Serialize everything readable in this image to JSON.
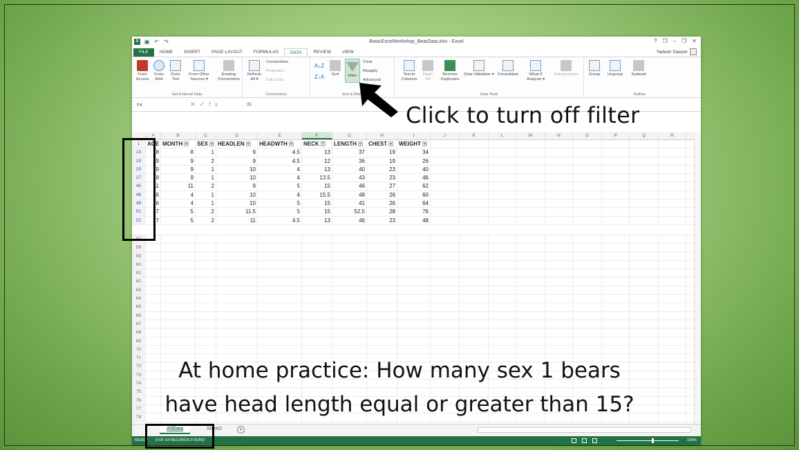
{
  "window": {
    "title": "BasicExcelWorkshop_BearData.xlsx - Excel",
    "controls": [
      "?",
      "❐",
      "–",
      "❐",
      "✕"
    ],
    "user": "Yadeeh Sawyer"
  },
  "tabs": [
    "FILE",
    "HOME",
    "INSERT",
    "PAGE LAYOUT",
    "FORMULAS",
    "DATA",
    "REVIEW",
    "VIEW"
  ],
  "active_tab": "DATA",
  "ribbon": {
    "get_external_data": {
      "name": "Get External Data",
      "buttons": [
        "From Access",
        "From Web",
        "From Text",
        "From Other Sources ▾",
        "Existing Connections"
      ]
    },
    "connections": {
      "name": "Connections",
      "refresh": "Refresh All ▾",
      "items": [
        "Connections",
        "Properties",
        "Edit Links"
      ]
    },
    "sort_filter": {
      "name": "Sort & Filter",
      "sort": "Sort",
      "filter": "Filter",
      "items": [
        "Clear",
        "Reapply",
        "Advanced"
      ]
    },
    "data_tools": {
      "name": "Data Tools",
      "buttons": [
        "Text to Columns",
        "Flash Fill",
        "Remove Duplicates",
        "Data Validation ▾",
        "Consolidate",
        "What-If Analysis ▾",
        "Relationships"
      ]
    },
    "outline": {
      "name": "Outline",
      "buttons": [
        "Group",
        "Ungroup",
        "Subtotal"
      ]
    }
  },
  "formula_bar": {
    "name_box": "F4",
    "value": "31"
  },
  "columns": [
    "A",
    "B",
    "C",
    "D",
    "E",
    "F",
    "G",
    "H",
    "I",
    "J",
    "K",
    "L",
    "M",
    "N",
    "O",
    "P",
    "Q",
    "R"
  ],
  "selected_column": "F",
  "headers": [
    "AGE",
    "MONTH",
    "SEX",
    "HEADLEN",
    "HEADWTH",
    "NECK",
    "LENGTH",
    "CHEST",
    "WEIGHT"
  ],
  "filtered_header": "NECK",
  "header_row_number": "1",
  "data_rows": [
    {
      "rn": "13",
      "vals": [
        "8",
        "8",
        "1",
        "9",
        "4.5",
        "13",
        "37",
        "19",
        "34"
      ]
    },
    {
      "rn": "19",
      "vals": [
        "9",
        "9",
        "2",
        "9",
        "4.5",
        "12",
        "36",
        "19",
        "26"
      ]
    },
    {
      "rn": "25",
      "vals": [
        "9",
        "9",
        "1",
        "10",
        "4",
        "13",
        "40",
        "23",
        "40"
      ]
    },
    {
      "rn": "27",
      "vals": [
        "9",
        "9",
        "1",
        "10",
        "4",
        "13.5",
        "43",
        "23",
        "46"
      ]
    },
    {
      "rn": "45",
      "vals": [
        "11",
        "11",
        "2",
        "9",
        "5",
        "15",
        "46",
        "27",
        "62"
      ]
    },
    {
      "rn": "48",
      "vals": [
        "16",
        "4",
        "1",
        "10",
        "4",
        "15.5",
        "48",
        "26",
        "60"
      ]
    },
    {
      "rn": "49",
      "vals": [
        "16",
        "4",
        "1",
        "10",
        "5",
        "15",
        "41",
        "26",
        "64"
      ]
    },
    {
      "rn": "51",
      "vals": [
        "17",
        "5",
        "2",
        "11.5",
        "5",
        "15",
        "52.5",
        "28",
        "76"
      ]
    },
    {
      "rn": "52",
      "vals": [
        "17",
        "5",
        "2",
        "11",
        "4.5",
        "13",
        "46",
        "23",
        "48"
      ]
    }
  ],
  "empty_row_numbers": [
    "57",
    "58",
    "59",
    "60",
    "61",
    "62",
    "63",
    "64",
    "65",
    "66",
    "67",
    "68",
    "69",
    "70",
    "71",
    "72",
    "73",
    "74",
    "75",
    "76",
    "77",
    "78"
  ],
  "sheets": [
    "AllData",
    "Sheet2"
  ],
  "active_sheet": "AllData",
  "status": {
    "ready": "READY",
    "records": "9 OF 54 RECORDS FOUND",
    "zoom": "100%"
  },
  "annotations": {
    "callout": "Click to turn off filter",
    "practice_line1": "At home practice: How many sex 1 bears",
    "practice_line2": "have head length equal or greater than 15?"
  },
  "colors": {
    "excel_green": "#217346",
    "filtered_row_number": "#1a4fd1",
    "background_green": "#8fbf6a"
  }
}
